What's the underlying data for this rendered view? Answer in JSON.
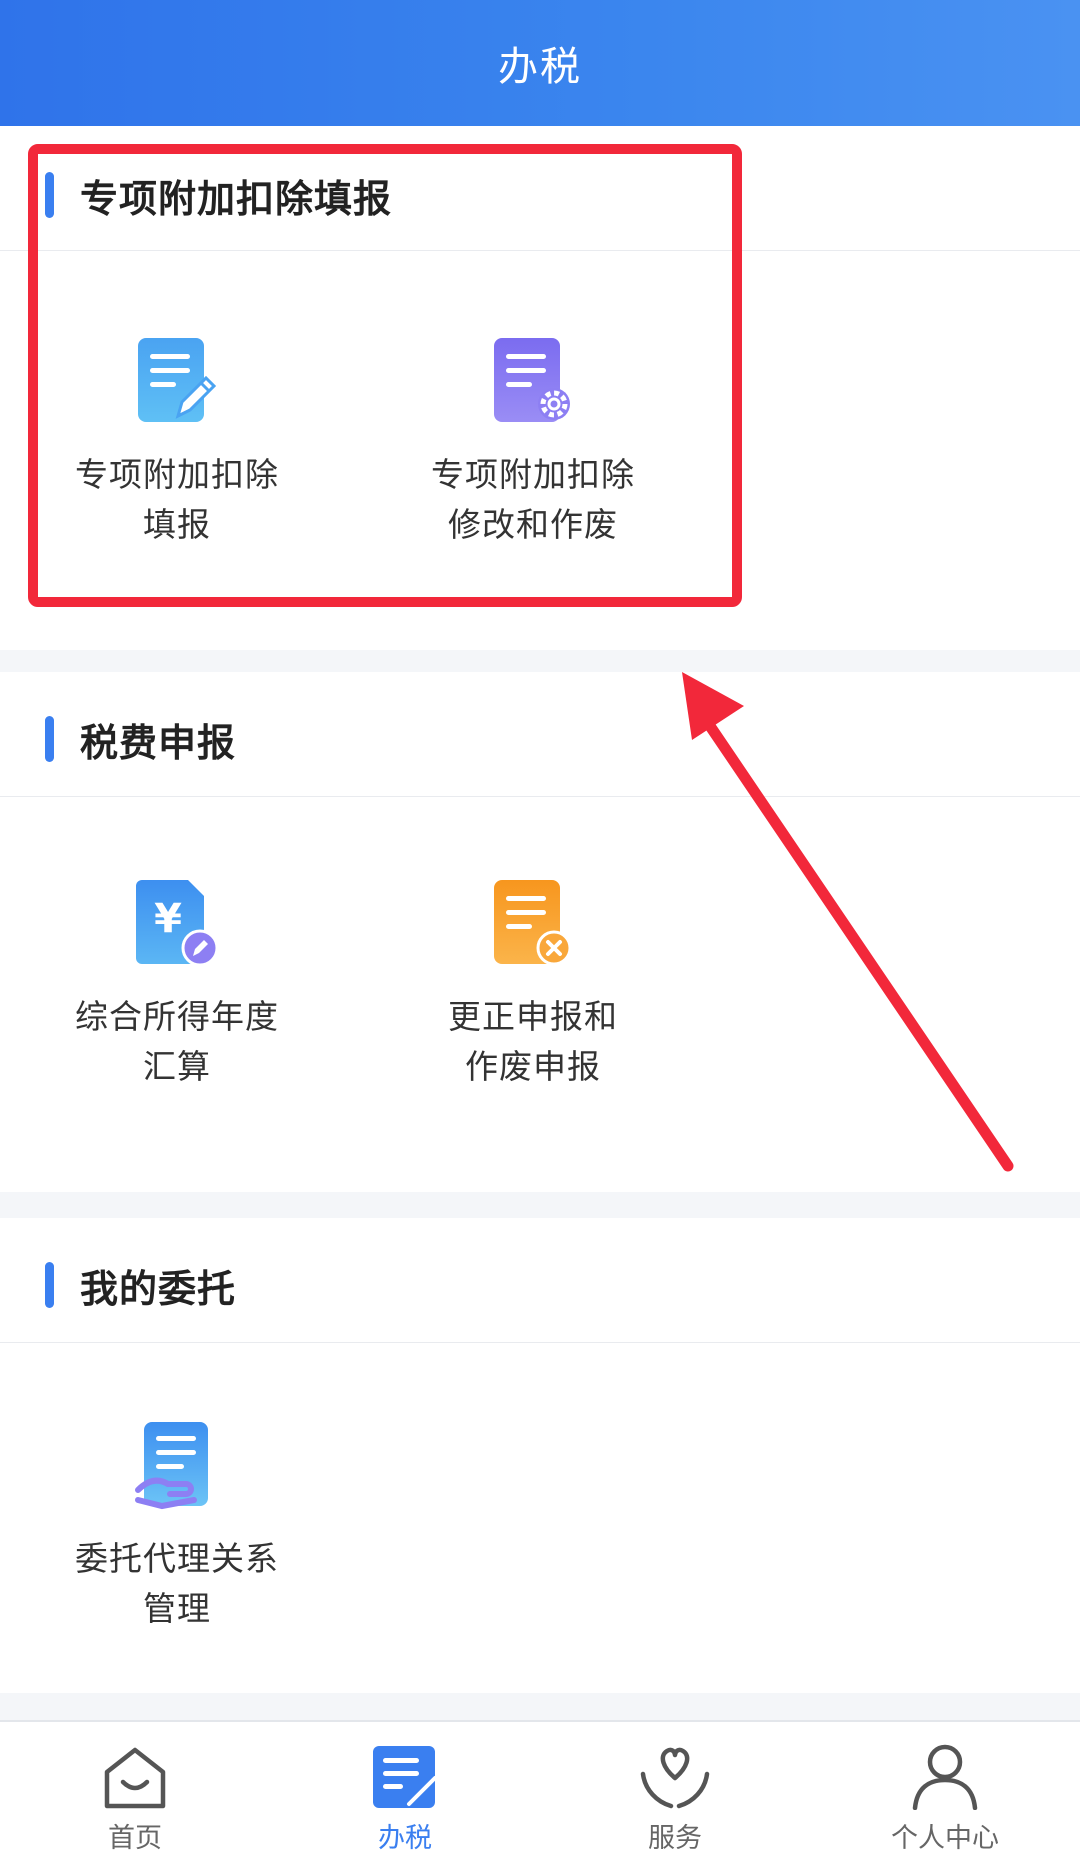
{
  "header": {
    "title": "办税"
  },
  "sections": [
    {
      "title": "专项附加扣除填报",
      "items": [
        {
          "label": "专项附加扣除\n填报",
          "icon": "document-edit-icon"
        },
        {
          "label": "专项附加扣除\n修改和作废",
          "icon": "document-settings-icon"
        }
      ]
    },
    {
      "title": "税费申报",
      "items": [
        {
          "label": "综合所得年度\n汇算",
          "icon": "yuan-document-icon"
        },
        {
          "label": "更正申报和\n作废申报",
          "icon": "document-cancel-icon"
        }
      ]
    },
    {
      "title": "我的委托",
      "items": [
        {
          "label": "委托代理关系\n管理",
          "icon": "hand-document-icon"
        }
      ]
    }
  ],
  "tabbar": {
    "active_index": 1,
    "items": [
      {
        "label": "首页",
        "icon": "home-icon"
      },
      {
        "label": "办税",
        "icon": "tax-document-icon"
      },
      {
        "label": "服务",
        "icon": "heart-hands-icon"
      },
      {
        "label": "个人中心",
        "icon": "user-icon"
      }
    ]
  },
  "colors": {
    "accent": "#3a7ff0",
    "header_gradient_start": "#2f73ea",
    "annotation_red": "#f2283a"
  }
}
